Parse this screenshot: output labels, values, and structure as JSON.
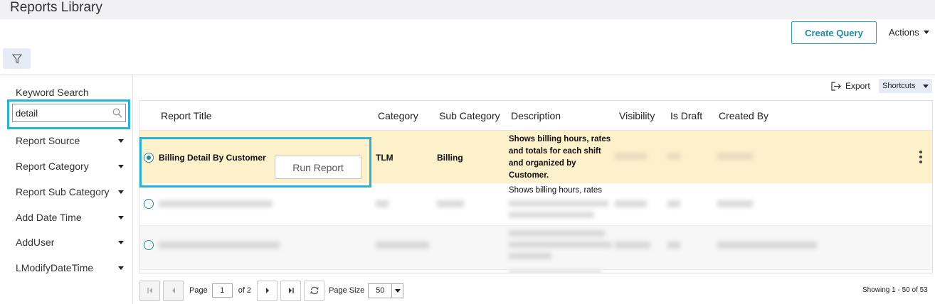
{
  "header": {
    "title": "Reports Library",
    "create_query": "Create Query",
    "actions": "Actions"
  },
  "sidebar": {
    "keyword_label": "Keyword Search",
    "keyword_value": "detail",
    "facets": [
      "Report Source",
      "Report Category",
      "Report Sub Category",
      "Add Date Time",
      "AddUser",
      "LModifyDateTime"
    ]
  },
  "toolbar": {
    "export": "Export",
    "shortcuts": "Shortcuts"
  },
  "table": {
    "columns": [
      "Report Title",
      "Category",
      "Sub Category",
      "Description",
      "Visibility",
      "Is Draft",
      "Created By"
    ],
    "selected_row": {
      "title": "Billing Detail By Customer",
      "category": "TLM",
      "sub_category": "Billing",
      "description": "Shows billing hours, rates and totals for each shift and organized by Customer.",
      "run_button": "Run Report"
    },
    "row2_desc_line1": "Shows billing hours, rates"
  },
  "pager": {
    "page_label": "Page",
    "page_value": "1",
    "of_label": "of 2",
    "page_size_label": "Page Size",
    "page_size_value": "50",
    "showing": "Showing 1 - 50 of 53"
  },
  "colors": {
    "accent": "#1d8aa0",
    "highlight": "#27b3d6",
    "selected_row": "#fdf1cc"
  }
}
